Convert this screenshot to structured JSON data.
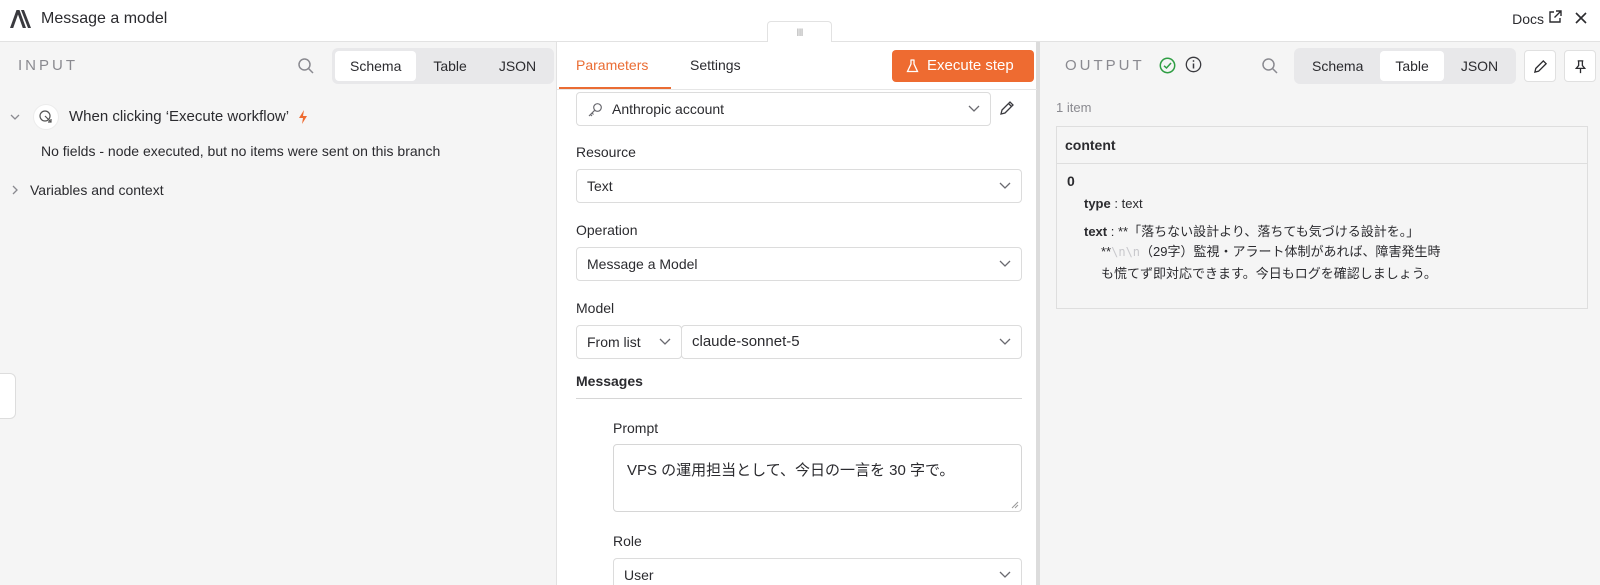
{
  "titlebar": {
    "title": "Message a model",
    "docs_label": "Docs",
    "handle_glyph": "III"
  },
  "input": {
    "label": "INPUT",
    "tabs": [
      "Schema",
      "Table",
      "JSON"
    ],
    "active_tab": "Schema",
    "trigger_label": "When clicking ‘Execute workflow’",
    "trigger_message": "No fields - node executed, but no items were sent on this branch",
    "variables_label": "Variables and context"
  },
  "params": {
    "tabs": [
      "Parameters",
      "Settings"
    ],
    "active_tab": "Parameters",
    "execute_label": "Execute step",
    "credential": "Anthropic account",
    "resource_label": "Resource",
    "resource_value": "Text",
    "operation_label": "Operation",
    "operation_value": "Message a Model",
    "model_label": "Model",
    "model_mode": "From list",
    "model_value": "claude-sonnet-5",
    "messages_label": "Messages",
    "prompt_label": "Prompt",
    "prompt_value": "VPS の運用担当として、今日の一言を 30 字で。",
    "role_label": "Role",
    "role_value": "User"
  },
  "output": {
    "label": "OUTPUT",
    "tabs": [
      "Schema",
      "Table",
      "JSON"
    ],
    "active_tab": "Table",
    "item_count": "1 item",
    "column": "content",
    "index": "0",
    "type_key": "type",
    "type_value": "text",
    "text_key": "text",
    "sep": ":",
    "text_line1": "**「落ちない設計より、落ちても気づける設計を。」",
    "text_stars": "**",
    "text_escape": "\\n\\n",
    "text_rest": "（29字）監視・アラート体制があれば、障害発生時も慌てず即対応できます。今日もログを確認しましょう。"
  },
  "colors": {
    "accent": "#ee6b31",
    "success": "#2f9e44"
  }
}
